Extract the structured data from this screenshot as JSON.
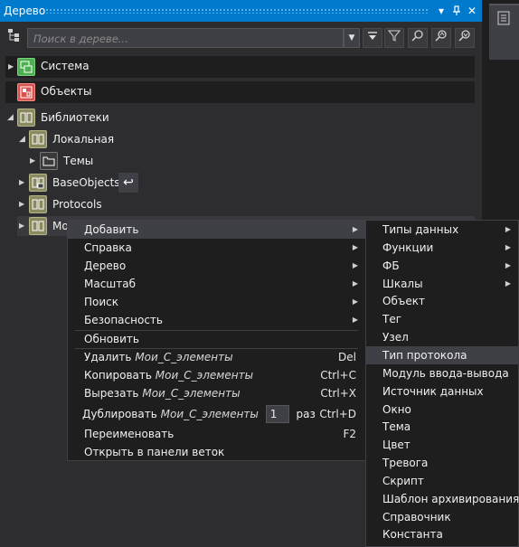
{
  "panel": {
    "title": "Дерево",
    "btn_dropdown": "▾",
    "btn_pin": "⊥",
    "btn_close": "✕"
  },
  "search": {
    "placeholder": "Поиск в дереве..."
  },
  "tree": {
    "roots": [
      {
        "label": "Система",
        "icon": "system-icon"
      },
      {
        "label": "Объекты",
        "icon": "objects-icon"
      }
    ],
    "libraries": {
      "label": "Библиотеки",
      "local": "Локальная",
      "themes": "Темы",
      "base_objects": "BaseObjects",
      "protocols": "Protocols",
      "my_partial": "Мо"
    }
  },
  "context_menu": {
    "add": "Добавить",
    "help": "Справка",
    "tree": "Дерево",
    "scale": "Масштаб",
    "search": "Поиск",
    "security": "Безопасность",
    "refresh": "Обновить",
    "delete": {
      "label": "Удалить",
      "target": "Мои_С_элементы",
      "shortcut": "Del"
    },
    "copy": {
      "label": "Копировать",
      "target": "Мои_С_элементы",
      "shortcut": "Ctrl+C"
    },
    "cut": {
      "label": "Вырезать",
      "target": "Мои_С_элементы",
      "shortcut": "Ctrl+X"
    },
    "duplicate": {
      "label": "Дублировать",
      "target": "Мои_С_элементы",
      "count": "1",
      "suffix": "раз",
      "shortcut": "Ctrl+D"
    },
    "rename": {
      "label": "Переименовать",
      "shortcut": "F2"
    },
    "open_branch": "Открыть в панели веток"
  },
  "submenu": {
    "items": [
      {
        "label": "Типы данных",
        "has_arrow": true
      },
      {
        "label": "Функции",
        "has_arrow": true
      },
      {
        "label": "ФБ",
        "has_arrow": true
      },
      {
        "label": "Шкалы",
        "has_arrow": true
      },
      {
        "label": "Объект",
        "has_arrow": false
      },
      {
        "label": "Тег",
        "has_arrow": false
      },
      {
        "label": "Узел",
        "has_arrow": false
      },
      {
        "label": "Тип протокола",
        "has_arrow": false,
        "highlighted": true
      },
      {
        "label": "Модуль ввода-вывода",
        "has_arrow": false
      },
      {
        "label": "Источник данных",
        "has_arrow": false
      },
      {
        "label": "Окно",
        "has_arrow": false
      },
      {
        "label": "Тема",
        "has_arrow": false
      },
      {
        "label": "Цвет",
        "has_arrow": false
      },
      {
        "label": "Тревога",
        "has_arrow": false
      },
      {
        "label": "Скрипт",
        "has_arrow": false
      },
      {
        "label": "Шаблон архивирования",
        "has_arrow": false
      },
      {
        "label": "Справочник",
        "has_arrow": false
      },
      {
        "label": "Константа",
        "has_arrow": false
      }
    ]
  },
  "colors": {
    "accent": "#007acc",
    "background": "#2d2d30",
    "menu_bg": "#1e1e1e",
    "highlight": "#3f3f46"
  }
}
